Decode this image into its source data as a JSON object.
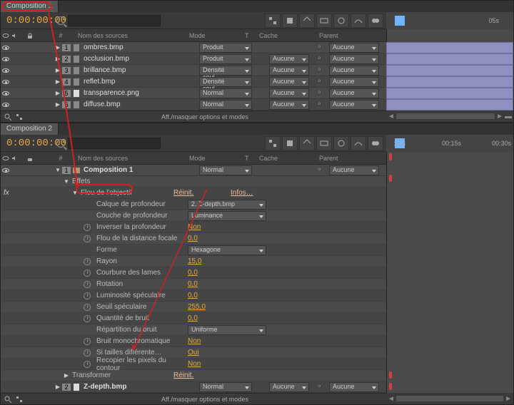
{
  "panel1": {
    "tab": "Composition 1",
    "timecode": "0:00:00:00",
    "search": "",
    "columns": {
      "name": "Nom des sources",
      "mode": "Mode",
      "t": "T",
      "cache": "Cache",
      "parent": "Parent"
    },
    "layers": [
      {
        "num": "1",
        "name": "ombres.bmp",
        "mode": "Produit",
        "cache": "",
        "parent": "Aucune"
      },
      {
        "num": "2",
        "name": "occlusion.bmp",
        "mode": "Produit",
        "cache": "Aucune",
        "parent": "Aucune"
      },
      {
        "num": "3",
        "name": "brillance.bmp",
        "mode": "Densité coul…",
        "cache": "Aucune",
        "parent": "Aucune"
      },
      {
        "num": "4",
        "name": "reflet.bmp",
        "mode": "Densité coul…",
        "cache": "Aucune",
        "parent": "Aucune"
      },
      {
        "num": "5",
        "name": "transparence.png",
        "mode": "Normal",
        "cache": "Aucune",
        "parent": "Aucune"
      },
      {
        "num": "6",
        "name": "diffuse.bmp",
        "mode": "Normal",
        "cache": "Aucune",
        "parent": "Aucune"
      }
    ],
    "toggle_text": "Aff./masquer options et modes",
    "time_markers": [
      "05s"
    ]
  },
  "panel2": {
    "tab": "Composition 2",
    "timecode": "0:00:00:00",
    "search": "",
    "columns": {
      "name": "Nom des sources",
      "mode": "Mode",
      "t": "T",
      "cache": "Cache",
      "parent": "Parent"
    },
    "layers": [
      {
        "num": "1",
        "name": "Composition 1",
        "mode": "Normal",
        "cache": "",
        "parent": "Aucune",
        "bold": true
      },
      {
        "num": "2",
        "name": "Z-depth.bmp",
        "mode": "Normal",
        "cache": "Aucune",
        "parent": "Aucune"
      }
    ],
    "effects_label": "Effets",
    "effect_name": "Flou de l'objectif",
    "reinit": "Réinit.",
    "infos": "Infos…",
    "props": [
      {
        "label": "Calque de profondeur",
        "type": "dd",
        "value": "2. Z-depth.bmp"
      },
      {
        "label": "Couche de profondeur",
        "type": "dd",
        "value": "Luminance"
      },
      {
        "label": "Inverser la profondeur",
        "type": "val",
        "value": "Non",
        "watch": true
      },
      {
        "label": "Flou de la distance focale",
        "type": "val",
        "value": "0,0",
        "watch": true
      },
      {
        "label": "Forme",
        "type": "dd",
        "value": "Hexagone"
      },
      {
        "label": "Rayon",
        "type": "val",
        "value": "15,0",
        "watch": true
      },
      {
        "label": "Courbure des lames",
        "type": "val",
        "value": "0,0",
        "watch": true
      },
      {
        "label": "Rotation",
        "type": "val",
        "value": "0,0",
        "watch": true
      },
      {
        "label": "Luminosité spéculaire",
        "type": "val",
        "value": "0,0",
        "watch": true
      },
      {
        "label": "Seuil spéculaire",
        "type": "val",
        "value": "255,0",
        "watch": true
      },
      {
        "label": "Quantité de bruit",
        "type": "val",
        "value": "0,0",
        "watch": true
      },
      {
        "label": "Répartition du bruit",
        "type": "dd",
        "value": "Uniforme"
      },
      {
        "label": "Bruit monochromatique",
        "type": "val",
        "value": "Non",
        "watch": true
      },
      {
        "label": "Si tailles différente…",
        "type": "val",
        "value": "Oui",
        "watch": true
      },
      {
        "label": "Recopier les pixels du contour",
        "type": "val",
        "value": "Non",
        "watch": true
      }
    ],
    "transform_label": "Transformer",
    "transform_value": "Réinit.",
    "toggle_text": "Aff./masquer options et modes",
    "time_markers": [
      ":00s",
      "00:15s",
      "00:30s"
    ]
  }
}
